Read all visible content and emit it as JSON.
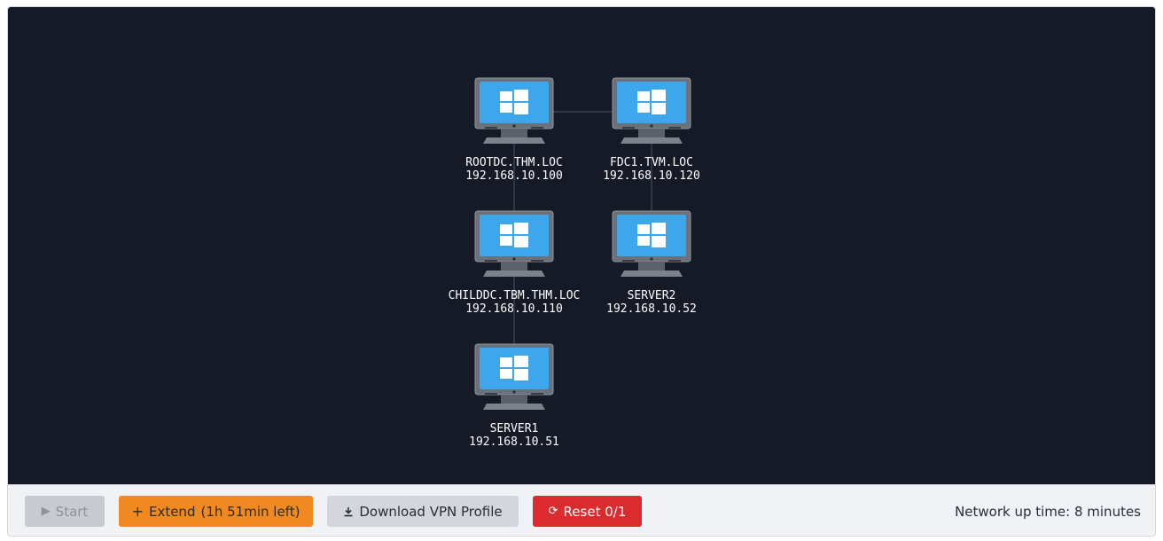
{
  "network": {
    "nodes": [
      {
        "name": "ROOTDC.THM.LOC",
        "ip": "192.168.10.100"
      },
      {
        "name": "FDC1.TVM.LOC",
        "ip": "192.168.10.120"
      },
      {
        "name": "CHILDDC.TBM.THM.LOC",
        "ip": "192.168.10.110"
      },
      {
        "name": "SERVER2",
        "ip": "192.168.10.52"
      },
      {
        "name": "SERVER1",
        "ip": "192.168.10.51"
      }
    ],
    "links": [
      {
        "from": "ROOTDC.THM.LOC",
        "to": "FDC1.TVM.LOC"
      },
      {
        "from": "ROOTDC.THM.LOC",
        "to": "CHILDDC.TBM.THM.LOC"
      },
      {
        "from": "CHILDDC.TBM.THM.LOC",
        "to": "SERVER1"
      },
      {
        "from": "FDC1.TVM.LOC",
        "to": "SERVER2"
      }
    ]
  },
  "toolbar": {
    "start_label": "Start",
    "start_icon": "play-icon",
    "extend_label": "Extend",
    "extend_time": "(1h 51min left)",
    "extend_icon": "plus-icon",
    "vpn_label": "Download VPN Profile",
    "vpn_icon": "download-icon",
    "reset_label": "Reset 0/1",
    "reset_icon": "refresh-icon",
    "uptime": "Network up time: 8 minutes"
  },
  "colors": {
    "canvas_bg": "#151a26",
    "screen": "#3ea7ec",
    "extend": "#f0891f",
    "reset": "#dc2b2f",
    "start_disabled": "#c7cad1"
  }
}
